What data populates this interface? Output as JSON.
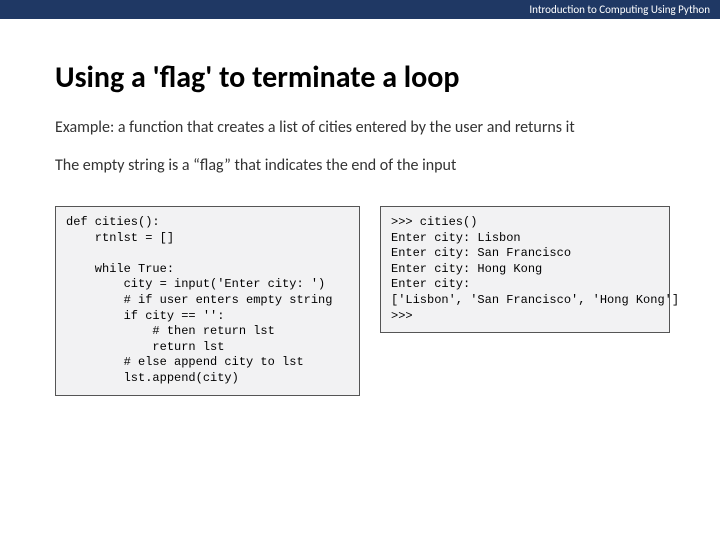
{
  "header": {
    "course": "Introduction to Computing Using Python"
  },
  "slide": {
    "title": "Using a 'flag' to terminate a loop",
    "para1": "Example: a function that creates a list of cities entered by the user and returns it",
    "para2": "The empty string is a “flag” that indicates the end of the input"
  },
  "code": {
    "definition": "def cities():\n    rtnlst = []\n\n    while True:\n        city = input('Enter city: ')\n        # if user enters empty string\n        if city == '':\n            # then return lst\n            return lst\n        # else append city to lst\n        lst.append(city)",
    "output": ">>> cities()\nEnter city: Lisbon\nEnter city: San Francisco\nEnter city: Hong Kong\nEnter city:\n['Lisbon', 'San Francisco', 'Hong Kong']\n>>>"
  }
}
